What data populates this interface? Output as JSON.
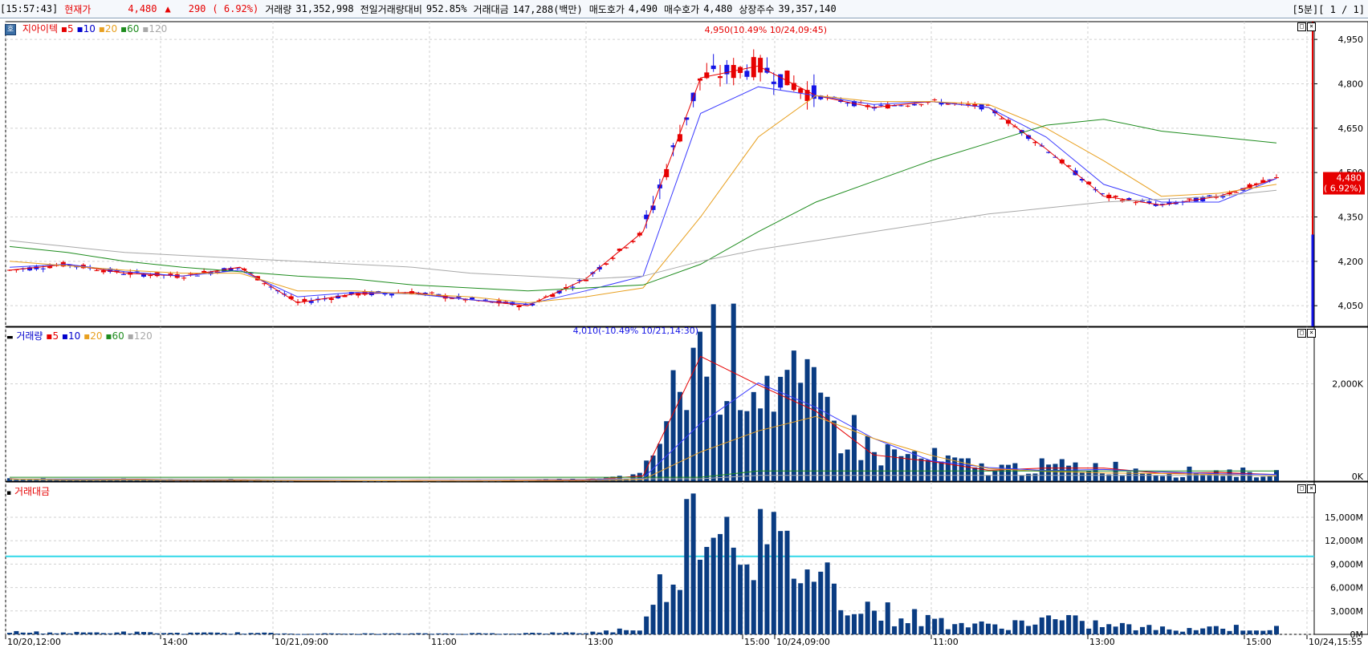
{
  "header": {
    "time": "[15:57:43]",
    "price_label": "현재가",
    "price": "4,480",
    "arrow": "▲",
    "change": "290",
    "change_pct": "( 6.92%)",
    "volume_label": "거래량",
    "volume": "31,352,998",
    "prev_vol_label": "전일거래량대비",
    "prev_vol": "952.85%",
    "amount_label": "거래대금",
    "amount": "147,288(백만)",
    "ask_label": "매도호가",
    "ask": "4,490",
    "bid_label": "매수호가",
    "bid": "4,480",
    "shares_label": "상장주수",
    "shares": "39,357,140",
    "period": "[5분][ 1 / 1]"
  },
  "panes": {
    "price": {
      "title": "지아이텍",
      "ma": [
        "5",
        "10",
        "20",
        "60",
        "120"
      ],
      "high_note": "4,950(10.49% 10/24,09:45)",
      "low_note": "4,010(-10.49% 10/21,14:30)",
      "current": "4,480",
      "current_pct": "( 6.92%)",
      "yticks": [
        "4,950",
        "4,800",
        "4,650",
        "4,500",
        "4,350",
        "4,200",
        "4,050"
      ]
    },
    "volume": {
      "title": "거래량",
      "ma": [
        "5",
        "10",
        "20",
        "60",
        "120"
      ],
      "yticks": [
        "2,000K",
        "0K"
      ]
    },
    "amount": {
      "title": "거래대금",
      "yticks": [
        "15,000M",
        "12,000M",
        "9,000M",
        "6,000M",
        "3,000M",
        "0M"
      ]
    }
  },
  "xaxis": [
    "10/20,12:00",
    "14:00",
    "10/21,09:00",
    "11:00",
    "13:00",
    "15:00",
    "10/24,09:00",
    "11:00",
    "13:00",
    "15:00",
    "10/24,15:55"
  ],
  "colors": {
    "up": "#e60000",
    "down": "#1414e6",
    "ma5": "#e60000",
    "ma10": "#3c3cff",
    "ma20": "#e8a020",
    "ma60": "#1e8c1e",
    "ma120": "#a8a8a8",
    "vol": "#0a3c82",
    "guide": "#30d8e8"
  },
  "chart_data": [
    {
      "type": "line",
      "title": "지아이텍",
      "series": [
        {
          "name": "5",
          "values": [
            4170,
            4190,
            4160,
            4150,
            4180,
            4060,
            4090,
            4095,
            4070,
            4050,
            4140,
            4300,
            4820,
            4860,
            4760,
            4720,
            4740,
            4720,
            4580,
            4420,
            4390,
            4420,
            4480
          ]
        },
        {
          "name": "10",
          "values": [
            4180,
            4190,
            4165,
            4150,
            4170,
            4080,
            4095,
            4090,
            4070,
            4055,
            4100,
            4150,
            4700,
            4790,
            4760,
            4730,
            4740,
            4720,
            4620,
            4460,
            4400,
            4400,
            4480
          ]
        },
        {
          "name": "20",
          "values": [
            4200,
            4185,
            4170,
            4160,
            4160,
            4100,
            4100,
            4090,
            4080,
            4060,
            4080,
            4110,
            4350,
            4620,
            4760,
            4740,
            4740,
            4730,
            4650,
            4540,
            4420,
            4430,
            4460
          ]
        },
        {
          "name": "60",
          "values": [
            4250,
            4230,
            4200,
            4180,
            4165,
            4150,
            4140,
            4120,
            4110,
            4100,
            4110,
            4120,
            4190,
            4300,
            4400,
            4470,
            4540,
            4600,
            4660,
            4680,
            4640,
            4620,
            4600
          ]
        },
        {
          "name": "120",
          "values": [
            4270,
            4250,
            4230,
            4220,
            4210,
            4200,
            4190,
            4180,
            4160,
            4150,
            4140,
            4150,
            4200,
            4240,
            4270,
            4300,
            4330,
            4360,
            4380,
            4400,
            4410,
            4420,
            4440
          ]
        }
      ],
      "ylim": [
        3980,
        5010
      ],
      "high": 4950,
      "low": 4010,
      "current": 4480
    },
    {
      "type": "bar",
      "title": "거래량",
      "values_k": [
        60,
        30,
        40,
        20,
        25,
        15,
        10,
        12,
        15,
        20,
        30,
        120,
        2850,
        2200,
        1600,
        600,
        450,
        250,
        300,
        300,
        180,
        200,
        150
      ],
      "ylim": [
        0,
        3000
      ]
    },
    {
      "type": "bar",
      "title": "거래대금",
      "values_m": [
        300,
        200,
        250,
        150,
        180,
        100,
        90,
        100,
        120,
        150,
        200,
        800,
        17000,
        12000,
        8000,
        3000,
        1800,
        1000,
        1900,
        1200,
        700,
        900,
        700
      ],
      "ylim": [
        0,
        18500
      ],
      "guide_line": 10000
    }
  ]
}
